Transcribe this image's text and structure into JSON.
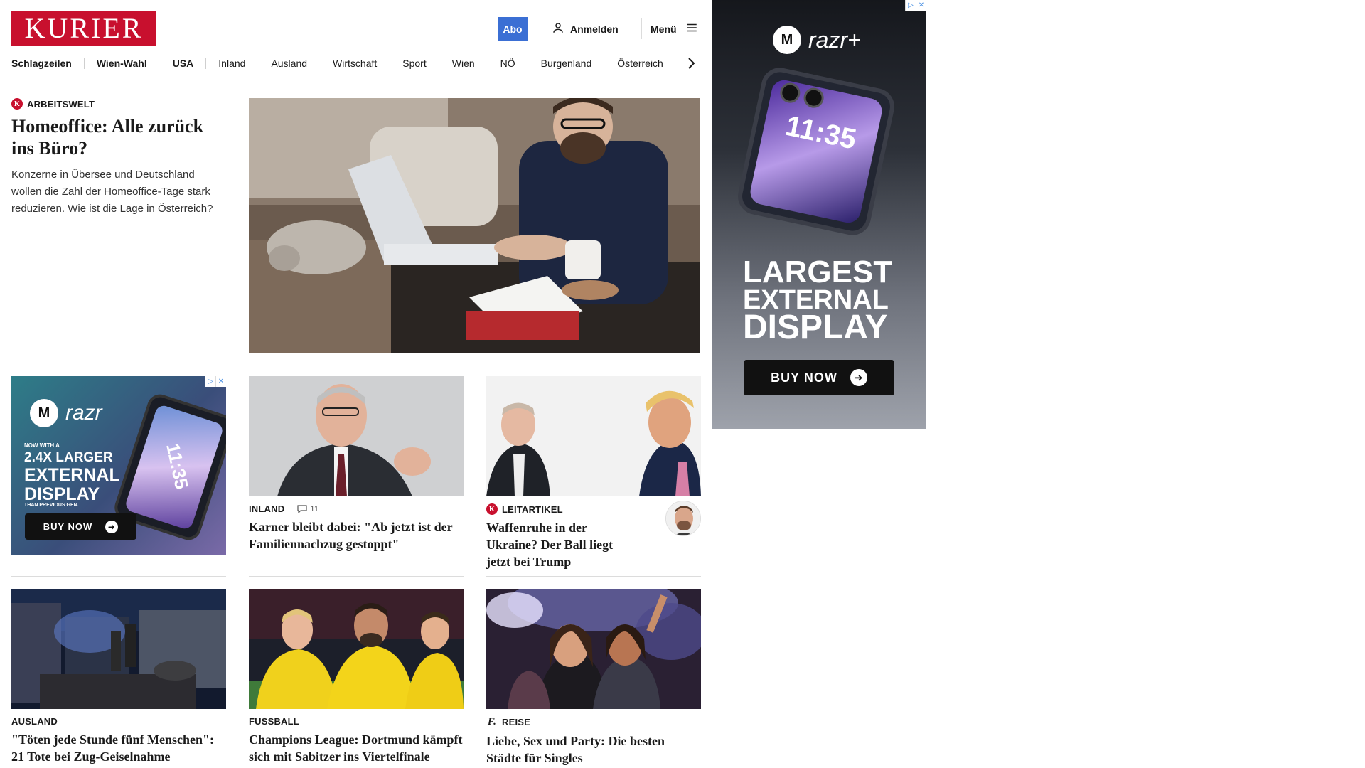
{
  "header": {
    "logo": "KURIER",
    "abo": "Abo",
    "login": "Anmelden",
    "menu": "Menü"
  },
  "nav": [
    "Schlagzeilen",
    "Wien-Wahl",
    "USA",
    "Inland",
    "Ausland",
    "Wirtschaft",
    "Sport",
    "Wien",
    "NÖ",
    "Burgenland",
    "Österreich"
  ],
  "lead": {
    "badge": "K",
    "kicker": "ARBEITSWELT",
    "title": "Homeoffice: Alle zurück ins Büro?",
    "teaser": "Konzerne in Übersee und Deutschland wollen die Zahl der Homeoffice-Tage stark reduzieren. Wie ist die Lage in Österreich?"
  },
  "cards": [
    {
      "kicker": "INLAND",
      "comments": "11",
      "title": "Karner bleibt dabei: \"Ab jetzt ist der Familiennachzug gestoppt\""
    },
    {
      "badge": "K",
      "kicker": "LEITARTIKEL",
      "title": "Waffenruhe in der Ukraine? Der Ball liegt jetzt bei Trump"
    },
    {
      "kicker": "AUSLAND",
      "title": "\"Töten jede Stunde fünf Menschen\": 21 Tote bei Zug-Geiselnahme"
    },
    {
      "kicker": "FUSSBALL",
      "title": "Champions League: Dortmund kämpft sich mit Sabitzer ins Viertelfinale"
    },
    {
      "badge": "f.",
      "kicker": "REISE",
      "title": "Liebe, Sex und Party: Die besten Städte für Singles"
    }
  ],
  "ad_small": {
    "brand": "razr",
    "sub": "NOW WITH A",
    "headline_1": "2.4X LARGER",
    "headline_2": "EXTERNAL",
    "headline_3": "DISPLAY",
    "foot": "THAN PREVIOUS GEN.",
    "cta": "BUY NOW",
    "phone_time": "11:35"
  },
  "ad_big": {
    "brand": "razr+",
    "headline_1": "LARGEST",
    "headline_2": "EXTERNAL",
    "headline_3": "DISPLAY",
    "cta": "BUY NOW",
    "phone_time": "11:35"
  },
  "colors": {
    "brand_red": "#c8102e",
    "abo_blue": "#3b6fd4"
  }
}
